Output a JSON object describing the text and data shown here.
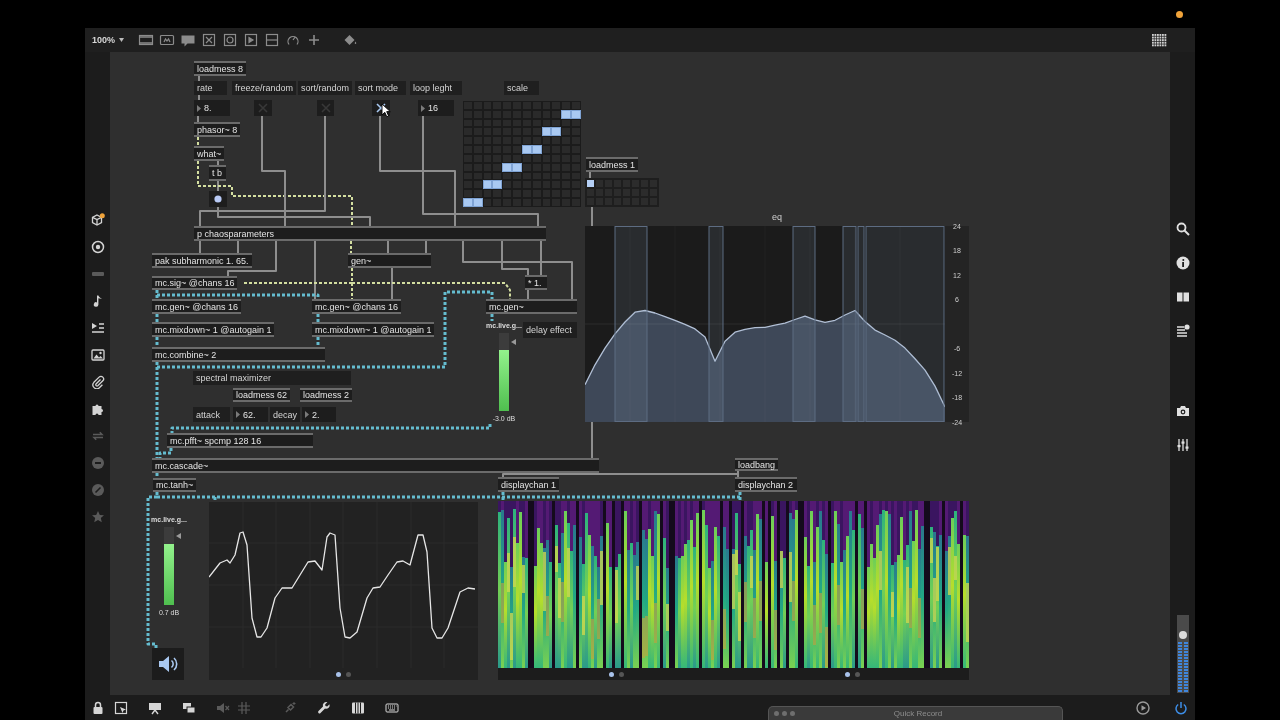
{
  "toolbar": {
    "zoom": "100%"
  },
  "left_sidebar": {
    "buttons": [
      {
        "disabled": false
      },
      {
        "disabled": false
      },
      {
        "disabled": true
      },
      {
        "disabled": false
      },
      {
        "disabled": false
      },
      {
        "disabled": false
      },
      {
        "disabled": false
      },
      {
        "disabled": false
      },
      {
        "disabled": true
      },
      {
        "disabled": true
      },
      {
        "disabled": true
      },
      {
        "disabled": true
      }
    ]
  },
  "patcher": {
    "items": [
      {
        "kind": "object",
        "text": "loadmess 8"
      },
      {
        "kind": "comment",
        "text": "rate"
      },
      {
        "kind": "comment",
        "text": "freeze/random"
      },
      {
        "kind": "comment",
        "text": "sort/random"
      },
      {
        "kind": "comment",
        "text": "sort mode"
      },
      {
        "kind": "comment",
        "text": "loop leght"
      },
      {
        "kind": "comment",
        "text": "scale"
      },
      {
        "kind": "number",
        "text": "8."
      },
      {
        "kind": "toggle",
        "checked": false
      },
      {
        "kind": "toggle",
        "checked": false
      },
      {
        "kind": "toggle",
        "checked": true
      },
      {
        "kind": "number",
        "text": "16"
      },
      {
        "kind": "matrix",
        "cells": [
          {
            "on": false
          },
          {
            "on": false
          },
          {
            "on": false
          },
          {
            "on": false
          },
          {
            "on": false
          },
          {
            "on": false
          },
          {
            "on": false
          },
          {
            "on": false
          },
          {
            "on": false
          },
          {
            "on": false
          },
          {
            "on": false
          },
          {
            "on": false
          },
          {
            "on": false
          },
          {
            "on": false
          },
          {
            "on": false
          },
          {
            "on": false
          },
          {
            "on": false
          },
          {
            "on": false
          },
          {
            "on": false
          },
          {
            "on": false
          },
          {
            "on": false
          },
          {
            "on": false
          },
          {
            "on": true
          },
          {
            "on": true
          },
          {
            "on": false
          },
          {
            "on": false
          },
          {
            "on": false
          },
          {
            "on": false
          },
          {
            "on": false
          },
          {
            "on": false
          },
          {
            "on": false
          },
          {
            "on": false
          },
          {
            "on": false
          },
          {
            "on": false
          },
          {
            "on": false
          },
          {
            "on": false
          },
          {
            "on": false
          },
          {
            "on": false
          },
          {
            "on": false
          },
          {
            "on": false
          },
          {
            "on": false
          },
          {
            "on": false
          },
          {
            "on": false
          },
          {
            "on": false
          },
          {
            "on": true
          },
          {
            "on": true
          },
          {
            "on": false
          },
          {
            "on": false
          },
          {
            "on": false
          },
          {
            "on": false
          },
          {
            "on": false
          },
          {
            "on": false
          },
          {
            "on": false
          },
          {
            "on": false
          },
          {
            "on": false
          },
          {
            "on": false
          },
          {
            "on": false
          },
          {
            "on": false
          },
          {
            "on": false
          },
          {
            "on": false
          },
          {
            "on": false
          },
          {
            "on": false
          },
          {
            "on": false
          },
          {
            "on": false
          },
          {
            "on": false
          },
          {
            "on": false
          },
          {
            "on": true
          },
          {
            "on": true
          },
          {
            "on": false
          },
          {
            "on": false
          },
          {
            "on": false
          },
          {
            "on": false
          },
          {
            "on": false
          },
          {
            "on": false
          },
          {
            "on": false
          },
          {
            "on": false
          },
          {
            "on": false
          },
          {
            "on": false
          },
          {
            "on": false
          },
          {
            "on": false
          },
          {
            "on": false
          },
          {
            "on": false
          },
          {
            "on": false
          },
          {
            "on": false
          },
          {
            "on": false
          },
          {
            "on": false
          },
          {
            "on": false
          },
          {
            "on": false
          },
          {
            "on": true
          },
          {
            "on": true
          },
          {
            "on": false
          },
          {
            "on": false
          },
          {
            "on": false
          },
          {
            "on": false
          },
          {
            "on": false
          },
          {
            "on": false
          },
          {
            "on": false
          },
          {
            "on": false
          },
          {
            "on": false
          },
          {
            "on": false
          },
          {
            "on": false
          },
          {
            "on": false
          },
          {
            "on": false
          },
          {
            "on": false
          },
          {
            "on": false
          },
          {
            "on": false
          },
          {
            "on": false
          },
          {
            "on": false
          },
          {
            "on": false
          },
          {
            "on": false
          },
          {
            "on": true
          },
          {
            "on": true
          },
          {
            "on": false
          },
          {
            "on": false
          },
          {
            "on": false
          },
          {
            "on": false
          },
          {
            "on": false
          },
          {
            "on": false
          },
          {
            "on": false
          },
          {
            "on": false
          },
          {
            "on": false
          },
          {
            "on": false
          },
          {
            "on": false
          },
          {
            "on": false
          },
          {
            "on": false
          },
          {
            "on": false
          },
          {
            "on": false
          },
          {
            "on": false
          },
          {
            "on": false
          },
          {
            "on": false
          },
          {
            "on": false
          },
          {
            "on": false
          },
          {
            "on": true
          },
          {
            "on": true
          },
          {
            "on": false
          },
          {
            "on": false
          },
          {
            "on": false
          },
          {
            "on": false
          },
          {
            "on": false
          },
          {
            "on": false
          },
          {
            "on": false
          },
          {
            "on": false
          },
          {
            "on": false
          },
          {
            "on": false
          }
        ]
      },
      {
        "kind": "object",
        "text": "phasor~ 8"
      },
      {
        "kind": "object",
        "text": "what~"
      },
      {
        "kind": "object",
        "text": "t b"
      },
      {
        "kind": "bang"
      },
      {
        "kind": "object",
        "text": "p chaosparameters"
      },
      {
        "kind": "object",
        "text": "loadmess 1"
      },
      {
        "kind": "matrix",
        "cells": [
          {
            "on": true
          },
          {
            "on": false
          },
          {
            "on": false
          },
          {
            "on": false
          },
          {
            "on": false
          },
          {
            "on": false
          },
          {
            "on": false
          },
          {
            "on": false
          },
          {
            "on": false
          },
          {
            "on": false
          },
          {
            "on": false
          },
          {
            "on": false
          },
          {
            "on": false
          },
          {
            "on": false
          },
          {
            "on": false
          },
          {
            "on": false
          },
          {
            "on": false
          },
          {
            "on": false
          },
          {
            "on": false
          },
          {
            "on": false
          },
          {
            "on": false
          },
          {
            "on": false
          },
          {
            "on": false
          },
          {
            "on": false
          }
        ]
      },
      {
        "kind": "object",
        "text": "pak subharmonic 1. 65."
      },
      {
        "kind": "object",
        "text": "gen~"
      },
      {
        "kind": "object",
        "text": "mc.sig~ @chans 16"
      },
      {
        "kind": "object",
        "text": "* 1."
      },
      {
        "kind": "object",
        "text": "mc.gen~ @chans 16"
      },
      {
        "kind": "object",
        "text": "mc.gen~ @chans 16"
      },
      {
        "kind": "object",
        "text": "mc.gen~"
      },
      {
        "kind": "object",
        "text": "mc.mixdown~ 1 @autogain 1"
      },
      {
        "kind": "object",
        "text": "mc.mixdown~ 1 @autogain 1"
      },
      {
        "kind": "gain",
        "label": "mc.live.g...",
        "level": 0.78,
        "reading": "-3.0 dB"
      },
      {
        "kind": "comment",
        "text": "delay effect"
      },
      {
        "kind": "object",
        "text": "mc.combine~ 2"
      },
      {
        "kind": "comment",
        "text": "spectral maximizer"
      },
      {
        "kind": "object",
        "text": "loadmess 62"
      },
      {
        "kind": "object",
        "text": "loadmess 2"
      },
      {
        "kind": "comment",
        "text": "attack"
      },
      {
        "kind": "number",
        "text": "62."
      },
      {
        "kind": "comment",
        "text": "decay"
      },
      {
        "kind": "number",
        "text": "2."
      },
      {
        "kind": "object",
        "text": "mc.pfft~ spcmp 128 16"
      },
      {
        "kind": "object",
        "text": "mc.cascade~"
      },
      {
        "kind": "object",
        "text": "loadbang"
      },
      {
        "kind": "object",
        "text": "mc.tanh~"
      },
      {
        "kind": "object",
        "text": "displaychan 1"
      },
      {
        "kind": "object",
        "text": "displaychan 2"
      },
      {
        "kind": "gain",
        "label": "mc.live.g...",
        "level": 0.78,
        "reading": "0.7 dB"
      },
      {
        "kind": "scope",
        "pages": [
          {
            "selected": true
          },
          {
            "selected": false
          }
        ]
      },
      {
        "kind": "spectrogram",
        "pages": [
          {
            "selected": true
          },
          {
            "selected": false
          }
        ]
      },
      {
        "kind": "spectrogram",
        "pages": [
          {
            "selected": true
          },
          {
            "selected": false
          }
        ]
      },
      {
        "kind": "ezdac",
        "on": true
      },
      {
        "kind": "filtergraph",
        "chart_data": {
          "type": "line",
          "title": "eq",
          "ylim": [
            -24,
            24
          ],
          "yticks": [
            24,
            18,
            12,
            6,
            -6,
            -12,
            -18,
            -24
          ],
          "values": [
            -14.9,
            -10.0,
            -5.9,
            -2.4,
            0.5,
            2.9,
            3.3,
            2.7,
            1.8,
            0.9,
            -0.1,
            -1.2,
            -3.2,
            -9.1,
            -4.2,
            -2.0,
            -1.3,
            -0.9,
            -0.8,
            -0.3,
            0.2,
            1.1,
            1.9,
            1.0,
            0.4,
            0.9,
            2.2,
            3.3,
            0.6,
            -1.5,
            -2.7,
            -4.0,
            -5.9,
            -8.5,
            -11.3,
            -15.2,
            -20.3
          ]
        }
      }
    ]
  },
  "right_sidebar": {
    "master_volume": {
      "level": 0.77
    }
  },
  "bottom_toolbar": {
    "buttons": [
      {
        "disabled": false
      },
      {
        "disabled": false
      },
      {
        "disabled": false
      },
      {
        "disabled": false
      },
      {
        "disabled": true
      },
      {
        "disabled": true
      },
      {
        "disabled": true
      },
      {
        "disabled": false
      },
      {
        "disabled": false
      },
      {
        "disabled": false
      }
    ],
    "audio_power": {
      "on": true
    }
  },
  "quick_record": {
    "title": "Quick Record"
  }
}
